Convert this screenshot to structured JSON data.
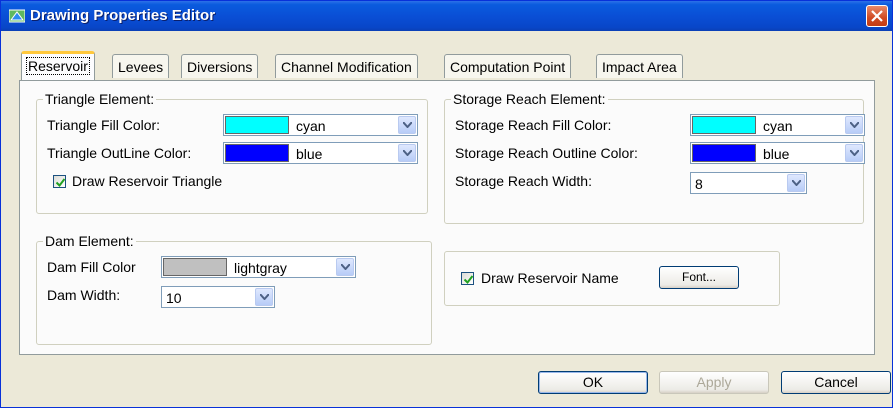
{
  "window": {
    "title": "Drawing Properties Editor",
    "close_icon": "close-icon"
  },
  "tabs": [
    "Reservoir",
    "Levees",
    "Diversions",
    "Channel Modification",
    "Computation Point",
    "Impact Area"
  ],
  "active_tab": "Reservoir",
  "triangle": {
    "legend": "Triangle Element:",
    "fill_label": "Triangle Fill Color:",
    "fill_value": "cyan",
    "fill_swatch": "#00ffff",
    "outline_label": "Triangle OutLine Color:",
    "outline_value": "blue",
    "outline_swatch": "#0000ff",
    "draw_checkbox_label": "Draw Reservoir Triangle",
    "draw_checked": true
  },
  "storage": {
    "legend": "Storage Reach Element:",
    "fill_label": "Storage Reach Fill Color:",
    "fill_value": "cyan",
    "fill_swatch": "#00ffff",
    "outline_label": "Storage Reach Outline Color:",
    "outline_value": "blue",
    "outline_swatch": "#0000ff",
    "width_label": "Storage Reach Width:",
    "width_value": "8"
  },
  "dam": {
    "legend": "Dam Element:",
    "fill_label": "Dam Fill Color",
    "fill_value": "lightgray",
    "fill_swatch": "#c0c0c0",
    "width_label": "Dam Width:",
    "width_value": "10"
  },
  "name": {
    "draw_checkbox_label": "Draw Reservoir Name",
    "draw_checked": true,
    "font_button": "Font..."
  },
  "buttons": {
    "ok": "OK",
    "apply": "Apply",
    "cancel": "Cancel"
  },
  "colors": {
    "titlebar": "#0a4fd6",
    "active_tab_accent": "#ffc83c",
    "dialog_bg": "#ece9d8"
  }
}
